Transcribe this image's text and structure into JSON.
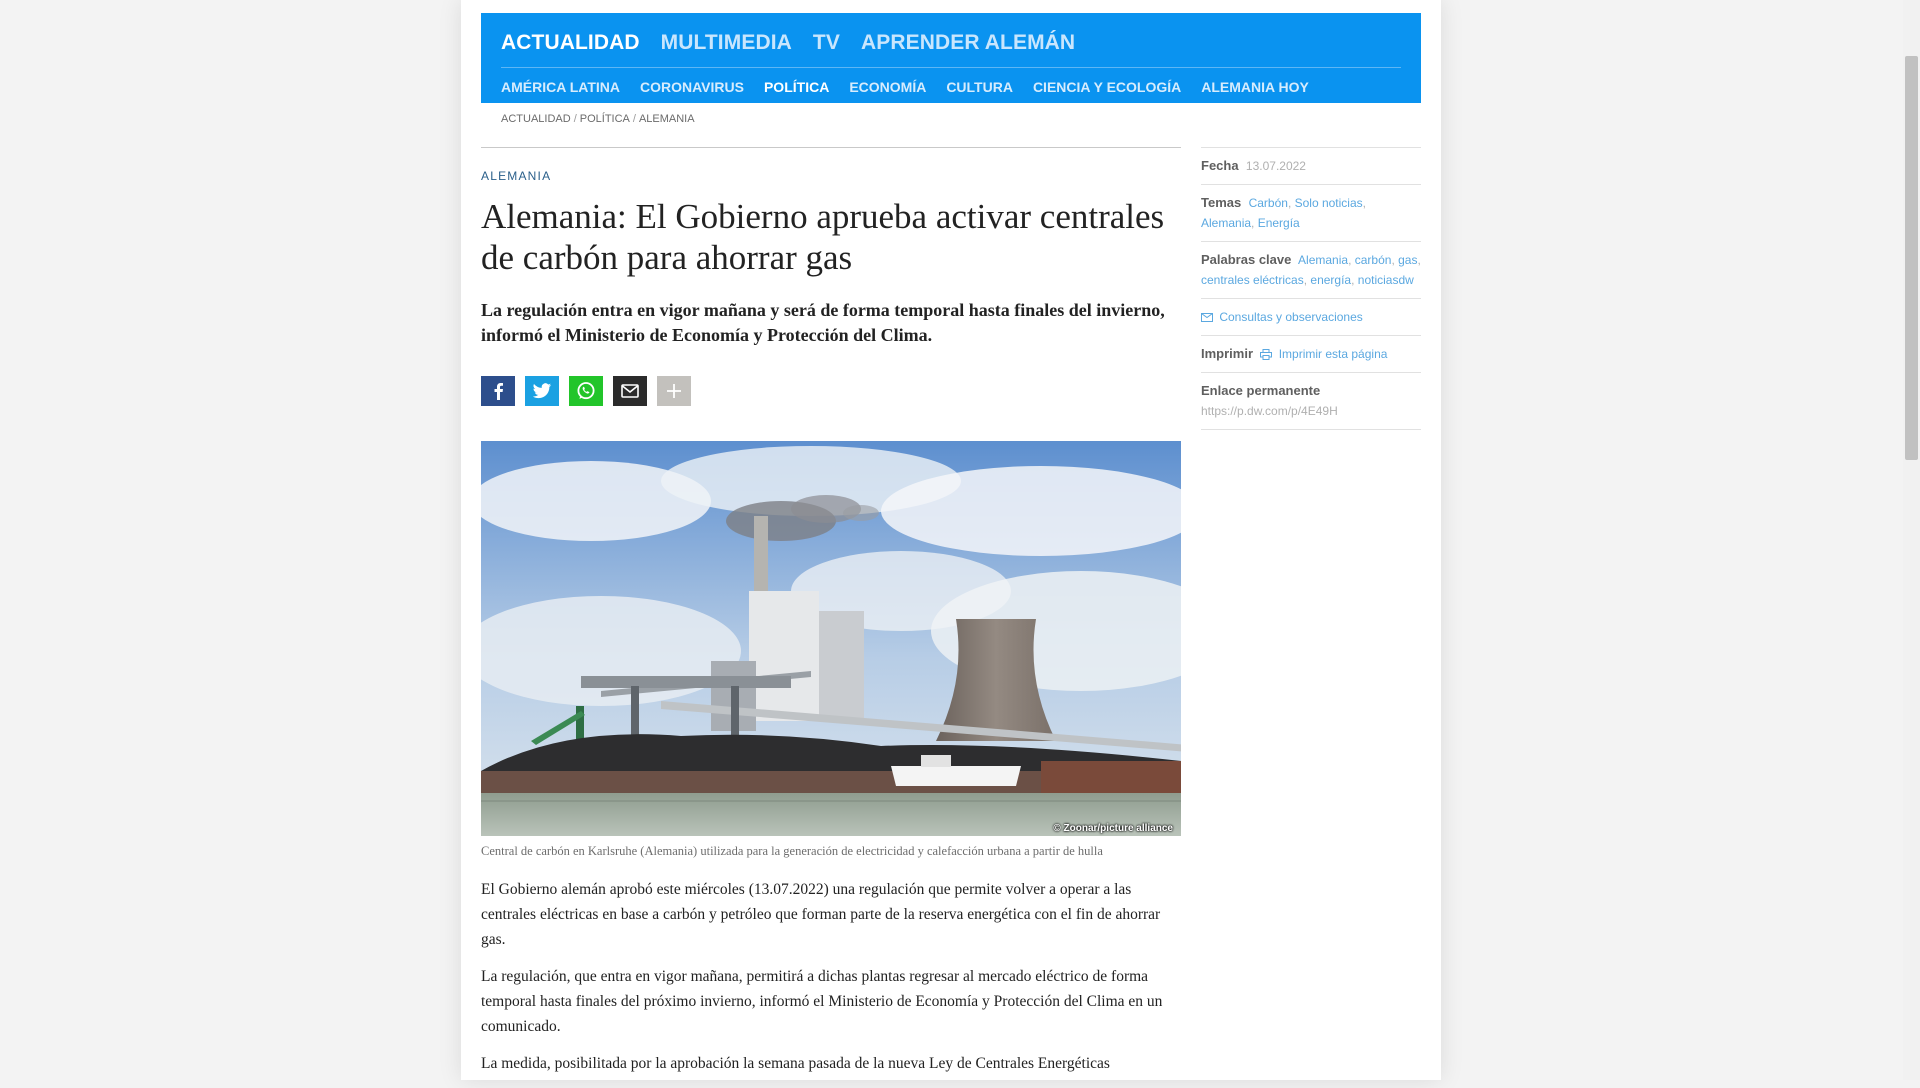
{
  "colors": {
    "nav_background": "#0a93f0",
    "link_blue": "#5ba8e0",
    "kicker_blue": "#2a5f8a"
  },
  "main_nav": [
    {
      "label": "ACTUALIDAD",
      "active": true
    },
    {
      "label": "MULTIMEDIA",
      "active": false
    },
    {
      "label": "TV",
      "active": false
    },
    {
      "label": "APRENDER ALEMÁN",
      "active": false
    }
  ],
  "sub_nav": [
    {
      "label": "AMÉRICA LATINA",
      "active": false
    },
    {
      "label": "CORONAVIRUS",
      "active": false
    },
    {
      "label": "POLÍTICA",
      "active": true
    },
    {
      "label": "ECONOMÍA",
      "active": false
    },
    {
      "label": "CULTURA",
      "active": false
    },
    {
      "label": "CIENCIA Y ECOLOGÍA",
      "active": false
    },
    {
      "label": "ALEMANIA HOY",
      "active": false
    }
  ],
  "breadcrumb": [
    "ACTUALIDAD",
    "POLÍTICA",
    "ALEMANIA"
  ],
  "article": {
    "kicker": "ALEMANIA",
    "title": "Alemania: El Gobierno aprueba activar centrales de carbón para ahorrar gas",
    "intro": "La regulación entra en vigor mañana y será de forma temporal hasta finales del invierno, informó el Ministerio de Economía y Protección del Clima.",
    "share_buttons": [
      "facebook-icon",
      "twitter-icon",
      "whatsapp-icon",
      "email-icon",
      "plus-icon"
    ],
    "image_credit": "© Zoonar/picture alliance",
    "image_caption": "Central de carbón en Karlsruhe (Alemania) utilizada para la generación de electricidad y calefacción urbana a partir de hulla",
    "paragraphs": [
      "El Gobierno alemán aprobó este miércoles (13.07.2022) una regulación que permite volver a operar a las centrales eléctricas en base a carbón y petróleo que forman parte de la reserva energética con el fin de ahorrar gas.",
      "La regulación, que entra en vigor mañana, permitirá a dichas plantas regresar al mercado eléctrico de forma temporal hasta finales del próximo invierno, informó el Ministerio de Economía y Protección del Clima en un comunicado.",
      "La medida, posibilitada por la aprobación la semana pasada de la nueva Ley de Centrales Energéticas"
    ]
  },
  "sidebar": {
    "date_label": "Fecha",
    "date_value": "13.07.2022",
    "topics_label": "Temas",
    "topics": [
      "Carbón",
      "Solo noticias",
      "Alemania",
      "Energía"
    ],
    "keywords_label": "Palabras clave",
    "keywords": [
      "Alemania",
      "carbón",
      "gas",
      "centrales eléctricas",
      "energía",
      "noticiasdw"
    ],
    "feedback_link": "Consultas y observaciones",
    "print_label": "Imprimir",
    "print_link": "Imprimir esta página",
    "permalink_label": "Enlace permanente",
    "permalink_value": "https://p.dw.com/p/4E49H"
  }
}
